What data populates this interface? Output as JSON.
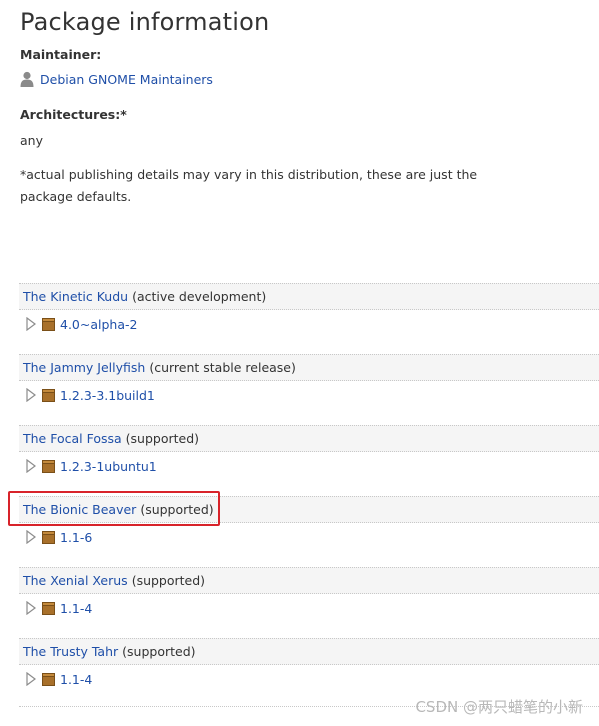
{
  "page": {
    "title": "Package information",
    "maintainer_label": "Maintainer:",
    "maintainer_name": "Debian GNOME Maintainers",
    "architectures_label": "Architectures:*",
    "architectures_value": "any",
    "footnote": "*actual publishing details may vary in this distribution, these are just the package defaults."
  },
  "series": [
    {
      "name": "The Kinetic Kudu",
      "status": "(active development)",
      "version": "4.0~alpha-2"
    },
    {
      "name": "The Jammy Jellyfish",
      "status": "(current stable release)",
      "version": "1.2.3-3.1build1"
    },
    {
      "name": "The Focal Fossa",
      "status": "(supported)",
      "version": "1.2.3-1ubuntu1"
    },
    {
      "name": "The Bionic Beaver",
      "status": "(supported)",
      "version": "1.1-6"
    },
    {
      "name": "The Xenial Xerus",
      "status": "(supported)",
      "version": "1.1-4"
    },
    {
      "name": "The Trusty Tahr",
      "status": "(supported)",
      "version": "1.1-4"
    }
  ],
  "icons": {
    "maintainer": "person-icon",
    "expander": "triangle-right-icon",
    "package": "package-icon"
  },
  "colors": {
    "link": "#1f4fa8",
    "highlight": "#d8232a",
    "package_brown": "#a8702a"
  },
  "watermark": "CSDN @两只蜡笔的小新"
}
